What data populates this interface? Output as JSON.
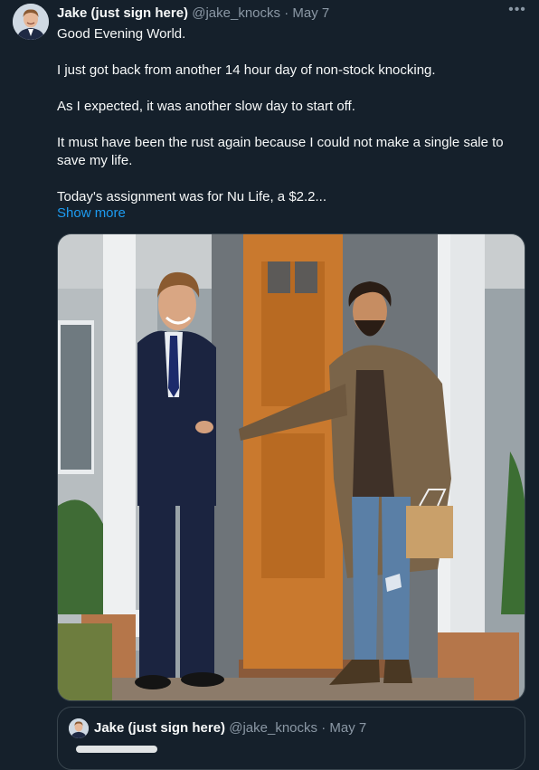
{
  "tweet": {
    "author_name": "Jake (just sign here)",
    "author_handle": "@jake_knocks",
    "separator": "·",
    "date": "May 7",
    "more_icon": "more-horizontal-icon",
    "paragraphs": [
      "Good Evening World.",
      "I just got back from another 14 hour day of non-stock knocking.",
      "As I expected, it was another slow day to start off.",
      "It must have been the rust again because I could not make a single sale to save my life.",
      "Today's assignment was for Nu Life, a $2.2..."
    ],
    "show_more": "Show more"
  },
  "quote": {
    "author_name": "Jake (just sign here)",
    "author_handle": "@jake_knocks",
    "separator": "·",
    "date": "May 7"
  },
  "colors": {
    "background": "#15202b",
    "text": "#f7f9f9",
    "secondary": "#8b98a5",
    "link": "#1d9bf0",
    "border": "#38444d"
  }
}
